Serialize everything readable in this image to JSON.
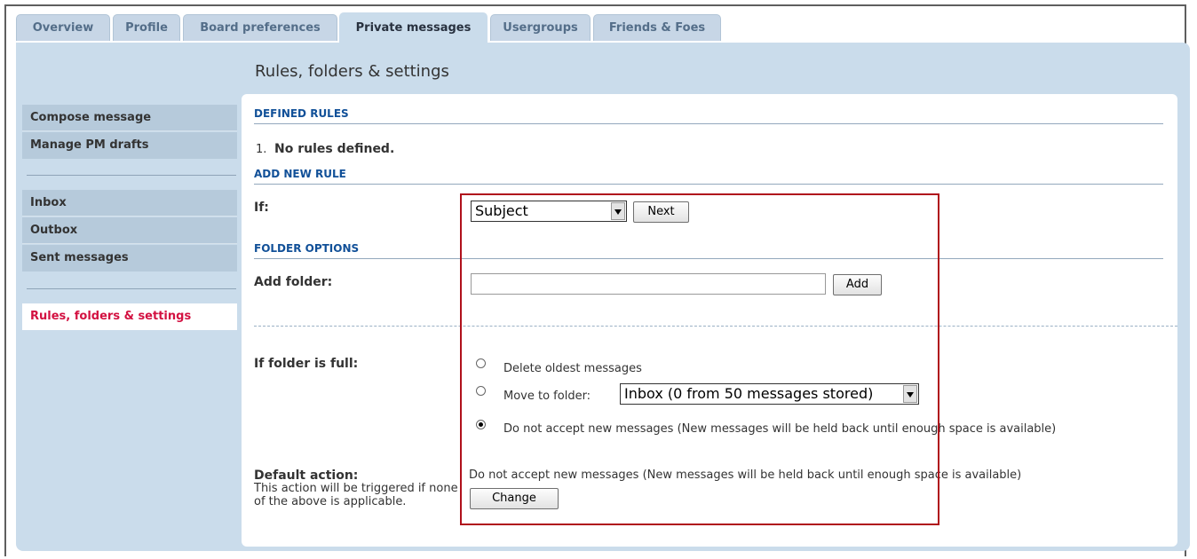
{
  "tabs": [
    "Overview",
    "Profile",
    "Board preferences",
    "Private messages",
    "Usergroups",
    "Friends & Foes"
  ],
  "page_title": "Rules, folders & settings",
  "sidebar": {
    "compose": "Compose message",
    "drafts": "Manage PM drafts",
    "inbox": "Inbox",
    "outbox": "Outbox",
    "sent": "Sent messages",
    "rules": "Rules, folders & settings"
  },
  "defined_rules": {
    "heading": "DEFINED RULES",
    "item_number": "1.",
    "item_text": "No rules defined."
  },
  "add_rule": {
    "heading": "ADD NEW RULE",
    "if_label": "If:",
    "select_value": "Subject",
    "next_label": "Next"
  },
  "folder_options": {
    "heading": "FOLDER OPTIONS",
    "add_folder_label": "Add folder:",
    "add_folder_value": "",
    "add_button": "Add"
  },
  "folder_full": {
    "label": "If folder is full:",
    "option_delete": "Delete oldest messages",
    "option_move": "Move to folder:",
    "move_select_value": "Inbox (0 from 50 messages stored)",
    "option_reject": "Do not accept new messages (New messages will be held back until enough space is available)",
    "selected": "reject"
  },
  "default_action": {
    "label": "Default action:",
    "description": "This action will be triggered if none of the above is applicable.",
    "current": "Do not accept new messages (New messages will be held back until enough space is available)",
    "change_button": "Change"
  },
  "colors": {
    "panel": "#cadceb",
    "sidebar_item": "#b6cadb",
    "active_link": "#d31141",
    "section_heading": "#115098",
    "highlight_box": "#b0101b"
  }
}
